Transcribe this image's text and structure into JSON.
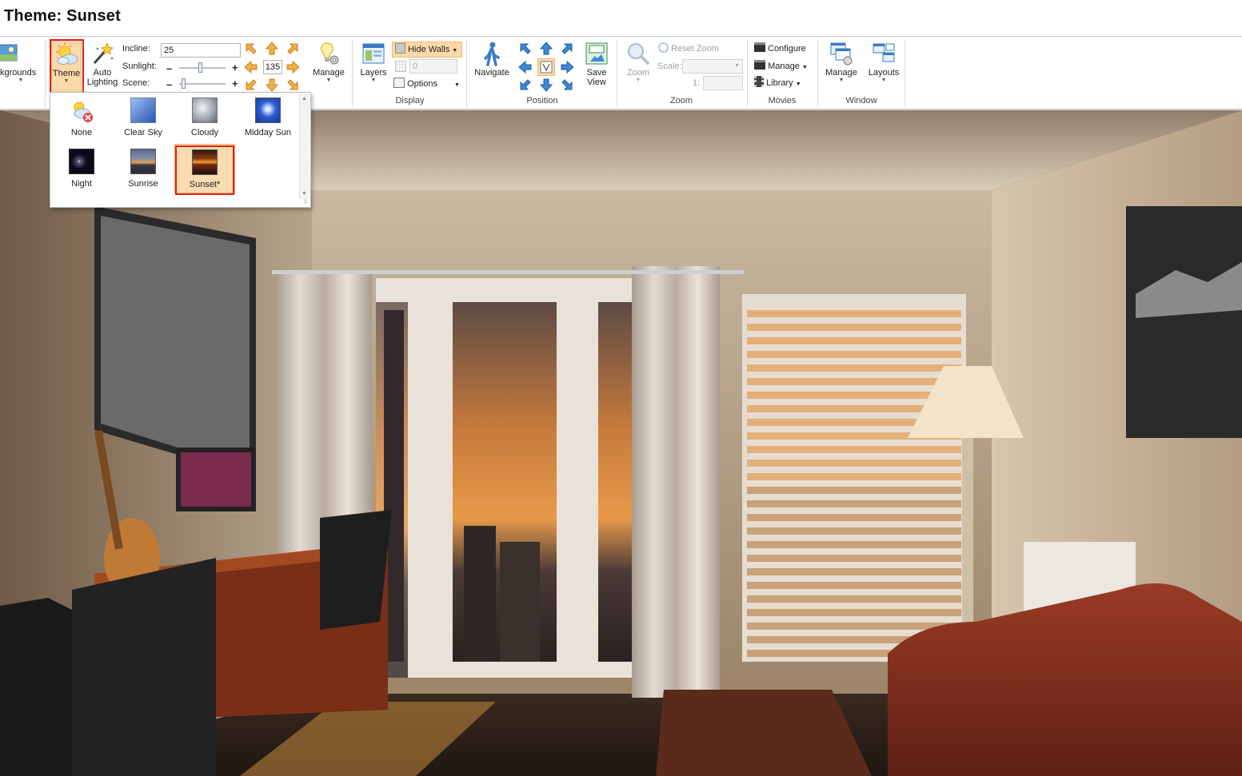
{
  "title": "Theme: Sunset",
  "ribbon": {
    "backgrounds_label": "kgrounds",
    "theme_label": "Theme",
    "auto_lighting_label": "Auto Lighting",
    "incline_label": "Incline:",
    "incline_value": "25",
    "sunlight_label": "Sunlight:",
    "scene_label": "Scene:",
    "sun_direction_value": "135",
    "manage_lighting_label": "Manage",
    "layers_label": "Layers",
    "hide_walls_label": "Hide Walls",
    "wall_height_value": "0",
    "options_label": "Options",
    "display_group": "Display",
    "navigate_label": "Navigate",
    "save_view_label": "Save View",
    "position_group": "Position",
    "zoom_label": "Zoom",
    "reset_zoom_label": "Reset Zoom",
    "scale_label": "Scale:",
    "ratio_label": "1:",
    "zoom_group": "Zoom",
    "configure_label": "Configure",
    "movies_manage_label": "Manage",
    "library_label": "Library",
    "movies_group": "Movies",
    "window_manage_label": "Manage",
    "layouts_label": "Layouts",
    "window_group": "Window"
  },
  "theme_gallery": {
    "items": [
      {
        "label": "None"
      },
      {
        "label": "Clear Sky"
      },
      {
        "label": "Cloudy"
      },
      {
        "label": "Midday Sun"
      },
      {
        "label": "Night"
      },
      {
        "label": "Sunrise"
      },
      {
        "label": "Sunset*",
        "selected": true
      }
    ]
  },
  "colors": {
    "highlight": "#e0201c",
    "selected_tile": "#fbdcb0",
    "accent_orange": "#e69a2e",
    "accent_blue": "#2a6fc9"
  }
}
